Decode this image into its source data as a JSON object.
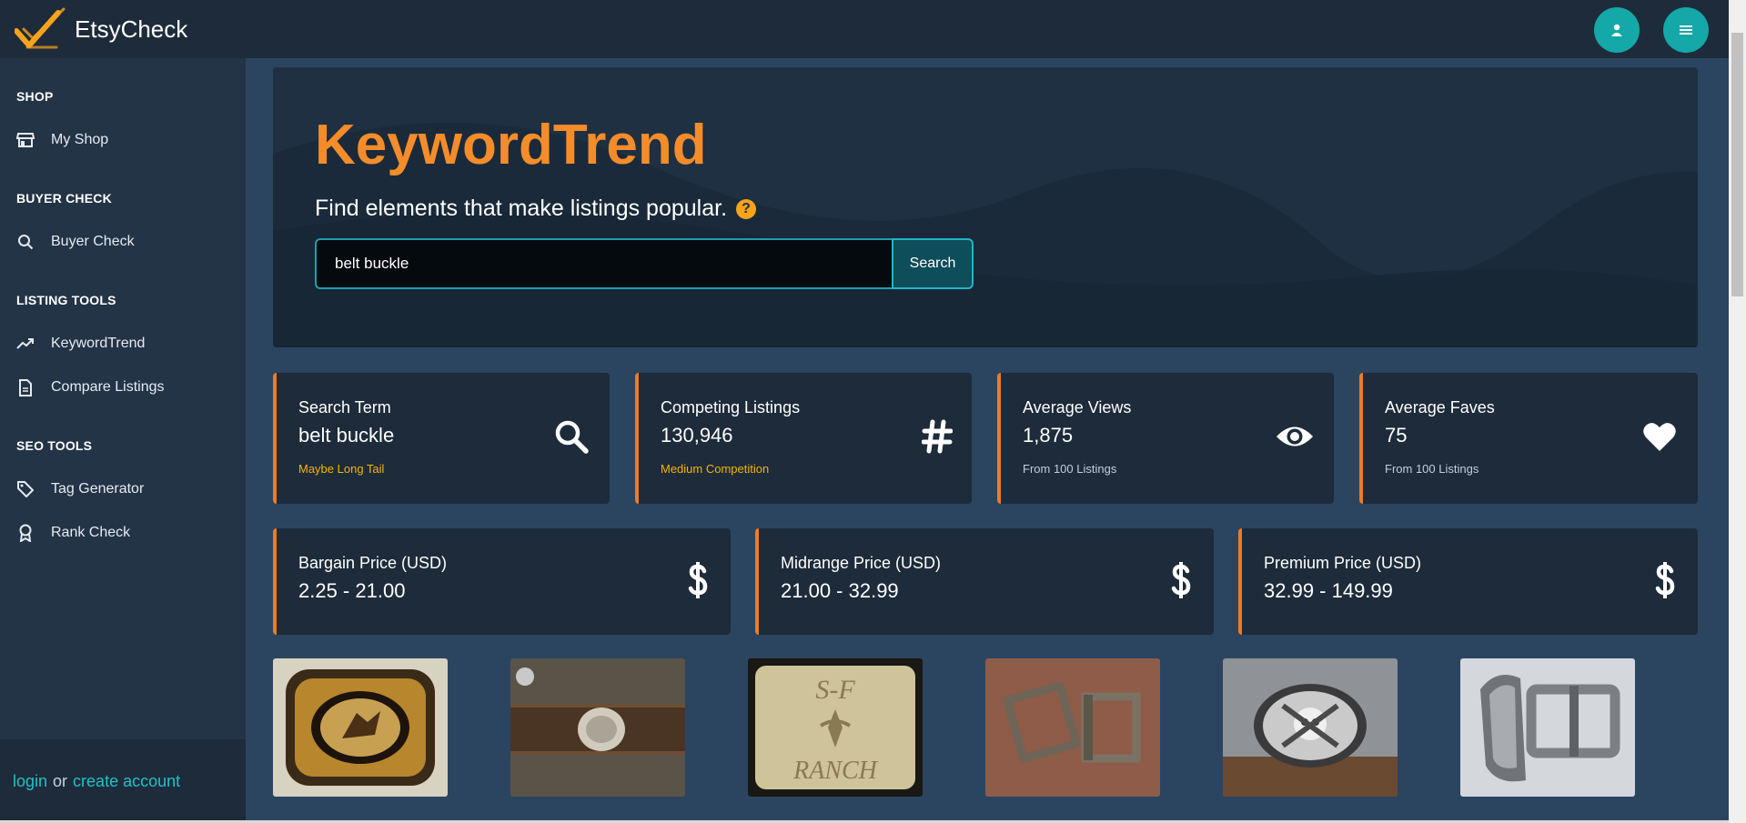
{
  "app": {
    "brand": "EtsyCheck"
  },
  "colors": {
    "accent": "#f58c2a",
    "teal": "#14a8a8",
    "warning_text": "#f6b400",
    "card_bg": "#1d2b3a"
  },
  "sidebar": {
    "sections": [
      {
        "title": "SHOP",
        "items": [
          {
            "label": "My Shop",
            "icon": "store-icon"
          }
        ]
      },
      {
        "title": "BUYER CHECK",
        "items": [
          {
            "label": "Buyer Check",
            "icon": "search-icon"
          }
        ]
      },
      {
        "title": "LISTING TOOLS",
        "items": [
          {
            "label": "KeywordTrend",
            "icon": "trend-icon"
          },
          {
            "label": "Compare Listings",
            "icon": "document-icon"
          }
        ]
      },
      {
        "title": "SEO TOOLS",
        "items": [
          {
            "label": "Tag Generator",
            "icon": "tag-icon"
          },
          {
            "label": "Rank Check",
            "icon": "award-icon"
          }
        ]
      }
    ],
    "footer": {
      "login": "login",
      "or": "or",
      "create": "create account"
    }
  },
  "hero": {
    "title": "KeywordTrend",
    "subtitle": "Find elements that make listings popular.",
    "help": "?",
    "search_value": "belt buckle",
    "search_button": "Search"
  },
  "stats": [
    {
      "label": "Search Term",
      "value": "belt buckle",
      "note": "Maybe Long Tail",
      "icon": "search-icon"
    },
    {
      "label": "Competing Listings",
      "value": "130,946",
      "note": "Medium Competition",
      "icon": "hash-icon"
    },
    {
      "label": "Average Views",
      "value": "1,875",
      "note": "From 100 Listings",
      "icon": "eye-icon"
    },
    {
      "label": "Average Faves",
      "value": "75",
      "note": "From 100 Listings",
      "icon": "heart-icon"
    }
  ],
  "prices": [
    {
      "label": "Bargain Price (USD)",
      "value": "2.25 - 21.00",
      "icon": "dollar-icon"
    },
    {
      "label": "Midrange Price (USD)",
      "value": "21.00 - 32.99",
      "icon": "dollar-icon"
    },
    {
      "label": "Premium Price (USD)",
      "value": "32.99 - 149.99",
      "icon": "dollar-icon"
    }
  ],
  "listing_images": [
    {
      "text_top": "",
      "text_bottom": ""
    },
    {
      "text_top": "",
      "text_bottom": ""
    },
    {
      "text_top": "S-F",
      "text_bottom": "RANCH"
    },
    {
      "text_top": "",
      "text_bottom": ""
    },
    {
      "text_top": "",
      "text_bottom": ""
    },
    {
      "text_top": "",
      "text_bottom": ""
    }
  ]
}
